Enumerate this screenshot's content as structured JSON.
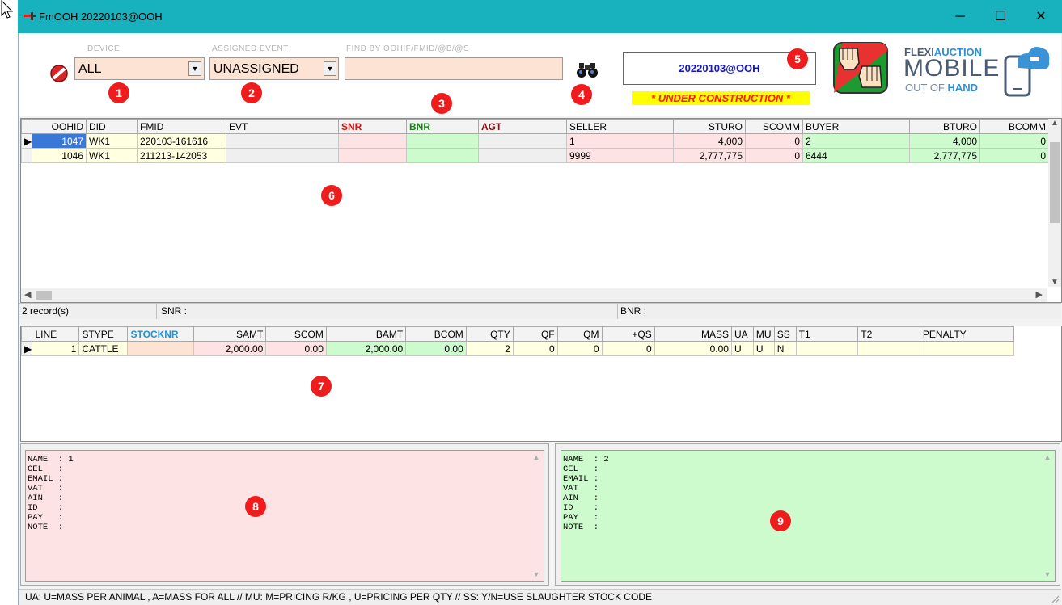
{
  "window": {
    "title": "FmOOH 20220103@OOH",
    "minimize": "─",
    "maximize": "☐",
    "close": "✕"
  },
  "header": {
    "device_label": "DEVICE",
    "device_value": "ALL",
    "event_label": "ASSIGNED EVENT",
    "event_value": "UNASSIGNED",
    "find_label": "FIND BY OOHIF/FMID/@B/@S",
    "find_value": "",
    "event_box": "20220103@OOH",
    "construction": "* UNDER CONSTRUCTION *",
    "brand_line1a": "FLEXI",
    "brand_line1b": "AUCTION",
    "brand_line2": "MOBILE",
    "brand_line3a": "OUT OF ",
    "brand_line3b": "HAND"
  },
  "badges": [
    "1",
    "2",
    "3",
    "4",
    "5",
    "6",
    "7",
    "8",
    "9"
  ],
  "records": {
    "columns": [
      "OOHID",
      "DID",
      "FMID",
      "EVT",
      "SNR",
      "BNR",
      "AGT",
      "SELLER",
      "STURO",
      "SCOMM",
      "BUYER",
      "BTURO",
      "BCOMM"
    ],
    "rows": [
      [
        "1047",
        "WK1",
        "220103-161616",
        "",
        "",
        "",
        "",
        "1",
        "4,000",
        "0",
        "2",
        "4,000",
        "0"
      ],
      [
        "1046",
        "WK1",
        "211213-142053",
        "",
        "",
        "",
        "",
        "9999",
        "2,777,775",
        "0",
        "6444",
        "2,777,775",
        "0"
      ]
    ],
    "status_count": "2 record(s)",
    "status_snr": "SNR :",
    "status_bnr": "BNR :"
  },
  "lines": {
    "columns": [
      "LINE",
      "STYPE",
      "STOCKNR",
      "SAMT",
      "SCOM",
      "BAMT",
      "BCOM",
      "QTY",
      "QF",
      "QM",
      "+QS",
      "MASS",
      "UA",
      "MU",
      "SS",
      "T1",
      "T2",
      "PENALTY"
    ],
    "rows": [
      [
        "1",
        "CATTLE",
        "",
        "2,000.00",
        "0.00",
        "2,000.00",
        "0.00",
        "2",
        "0",
        "0",
        "0",
        "0.00",
        "U",
        "U",
        "N",
        "",
        "",
        ""
      ]
    ]
  },
  "seller_memo": "NAME  : 1\nCEL   :\nEMAIL :\nVAT   :\nAIN   :\nID    :\nPAY   :\nNOTE  :",
  "buyer_memo": "NAME  : 2\nCEL   :\nEMAIL :\nVAT   :\nAIN   :\nID    :\nPAY   :\nNOTE  :",
  "footer": "UA: U=MASS PER ANIMAL , A=MASS FOR ALL  //  MU:  M=PRICING  R/KG , U=PRICING PER QTY // SS:  Y/N=USE SLAUGHTER STOCK CODE",
  "colors": {
    "titlebar": "#17b2bd",
    "seller_pink": "#fde3e3",
    "buyer_green": "#cdfbcd",
    "badge_red": "#ee1c1c",
    "construction_yellow": "#ffff00"
  }
}
